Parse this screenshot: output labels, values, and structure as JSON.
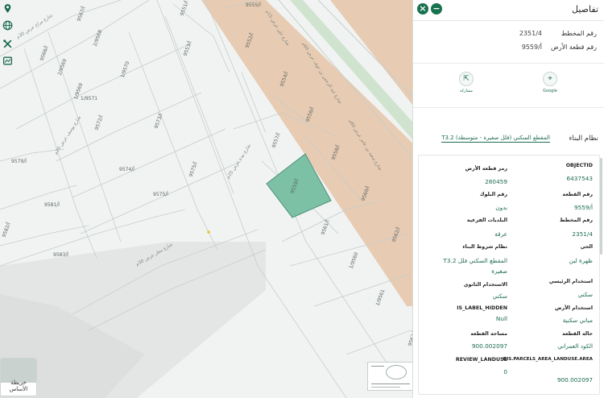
{
  "map": {
    "plots": {
      "p9551": "9551/أ",
      "p9552": "9552/أ",
      "p9553": "9553/أ",
      "p9554": "9554/أ",
      "p9555": "9555/أ",
      "p9556": "9556/أ",
      "p9557": "9557/أ",
      "p9558": "9558/أ",
      "p9559": "9559/أ",
      "p9560": "9560/أ",
      "p9561": "9561/أ",
      "p9562": "9562/أ",
      "p9563": "9563/أ",
      "p9565": "9565/أ",
      "p9566": "9566/أ",
      "p9567": "9567/أ",
      "p9568": "2/9568",
      "p9569": "1/9569",
      "p9569b": "2/9569",
      "p9570": "1/9570",
      "p9571": "1/9571",
      "p9572": "9572/أ",
      "p9573": "9573/أ",
      "p9574": "9574/أ",
      "p9575": "9575/أ",
      "p9579": "9579/أ",
      "p9581": "9581/أ",
      "p9582": "9582/أ",
      "p9583": "9583/أ",
      "p1560": "1/9560",
      "p1561": "1/9561"
    },
    "streets": {
      "s1": "شارع مراح عرض 30م",
      "s2": "شارع مطر عرض 30م",
      "s3": "شارع بيدة عرض 25م",
      "s4": "شارع يوسف عرض 20م",
      "s5": "شارع علي عرض 15م",
      "s6": "شارع عبد الرحمن بن عوف عرض 60م",
      "s7": "شارع سعيد بن عامر عرض 60م"
    },
    "colors": {
      "parcel_selected": "#7cc1a6",
      "road_band": "#e8cbb3"
    }
  },
  "toolbar": {
    "icons": [
      "location-pin-icon",
      "globe-icon",
      "tools-icon",
      "basemap-icon"
    ]
  },
  "basemap": {
    "label": "خريطة الأساس"
  },
  "panel": {
    "title": "تفاصيل",
    "summary": {
      "plan_label": "رقم المخطط",
      "plan_value": "2351/4",
      "parcel_label": "رقم قطعة الأرض",
      "parcel_value": "9559/أ"
    },
    "actions": {
      "google": "Google",
      "share": "مشاركة"
    },
    "building": {
      "label": "نظام البناء",
      "value": "T3.2 المقطع السكني (فلل صغيرة - متوسطة)"
    },
    "attributes": {
      "objectid_k": "OBJECTID",
      "objectid_v": "6437543",
      "parcel_code_k": "رمز قطعة الأرض",
      "parcel_code_v": "280459",
      "parcel_no_k": "رقم القطعة",
      "parcel_no_v": "9559/أ",
      "block_k": "رقم البلوك",
      "block_v": "بدون",
      "plan_k": "رقم المخطط",
      "plan_v": "2351/4",
      "municipality_k": "البلديات الفرعية",
      "municipality_v": "عرقة",
      "district_k": "الحي",
      "district_v": "ظهرة لبن",
      "bldg_cond_k": "نظام شروط البناء",
      "bldg_cond_v": "T3.2 المقطع السكني فلل صغيرة",
      "main_use_k": "استخدام الرئيسي",
      "main_use_v": "سكني",
      "second_use_k": "الاستخدام الثانوي",
      "second_use_v": "سكني",
      "land_use_k": "استخدام الأرض",
      "land_use_v": "مباني سكنية",
      "label_hidden_k": "IS_LABEL_HIDDEN",
      "label_hidden_v": "Null",
      "parcel_state_k": "حالة القطعة",
      "parcel_state_v": "الكود العمراني",
      "area_k": "مساحة القطعة",
      "area_v": "900.002097",
      "review_k": "REVIEW_LANDUSE",
      "review_v": "0",
      "gis_area_k": "GIS.PARCELS_AREA_LANDUSE.AREA",
      "gis_area_v": "900.002097"
    }
  }
}
